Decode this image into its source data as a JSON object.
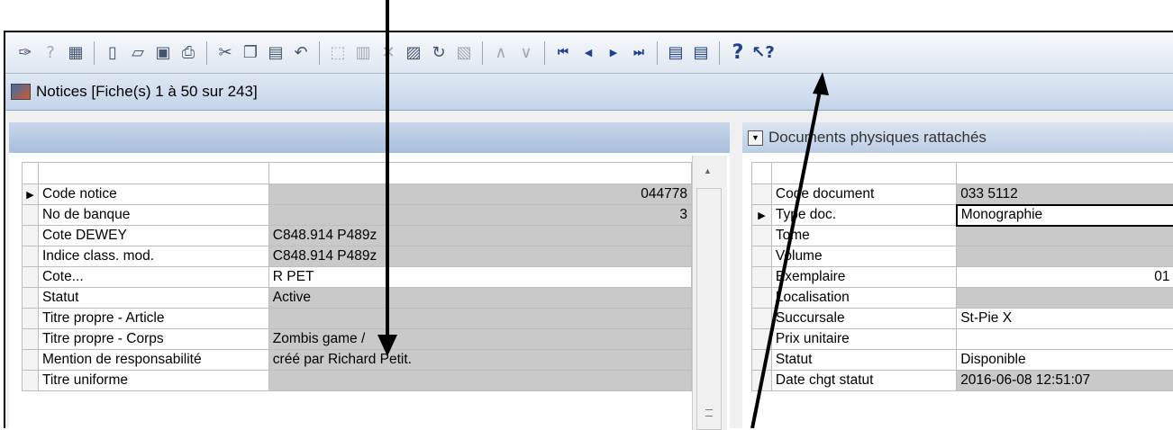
{
  "toolbar": {
    "icons": [
      "chart-edit-icon",
      "help-small-icon",
      "grid-icon",
      "new-document-icon",
      "open-folder-icon",
      "save-icon",
      "print-icon",
      "cut-icon",
      "copy-icon",
      "paste-icon",
      "undo-icon",
      "select-frame-icon",
      "book-icon",
      "delete-icon",
      "sheet-icon",
      "refresh-icon",
      "properties-icon",
      "up-chevron-icon",
      "down-chevron-icon",
      "first-record-icon",
      "previous-record-icon",
      "next-record-icon",
      "last-record-icon",
      "form-view-icon",
      "list-view-icon",
      "help-icon",
      "context-help-icon"
    ]
  },
  "window": {
    "title": "Notices [Fiche(s) 1 à 50 sur 243]"
  },
  "left_table": {
    "rows": [
      {
        "label": "Code notice",
        "value": "044778",
        "align": "right",
        "style": "grey",
        "current": true
      },
      {
        "label": "No de banque",
        "value": "3",
        "align": "right",
        "style": "grey",
        "current": false
      },
      {
        "label": "Cote DEWEY",
        "value": "C848.914 P489z",
        "align": "left",
        "style": "grey",
        "current": false
      },
      {
        "label": "Indice class. mod.",
        "value": "C848.914 P489z",
        "align": "left",
        "style": "grey",
        "current": false
      },
      {
        "label": "Cote...",
        "value": "R PET",
        "align": "left",
        "style": "white",
        "current": false
      },
      {
        "label": "Statut",
        "value": "Active",
        "align": "left",
        "style": "grey",
        "current": false
      },
      {
        "label": "Titre propre - Article",
        "value": "",
        "align": "left",
        "style": "grey",
        "current": false
      },
      {
        "label": "Titre propre - Corps",
        "value": "Zombis game /",
        "align": "left",
        "style": "grey",
        "current": false
      },
      {
        "label": "Mention de responsabilité",
        "value": "créé par Richard Petit.",
        "align": "left",
        "style": "grey",
        "current": false
      },
      {
        "label": "Titre uniforme",
        "value": "",
        "align": "left",
        "style": "grey",
        "current": false
      }
    ]
  },
  "right_panel": {
    "title": "Documents physiques rattachés",
    "rows": [
      {
        "label": "Code document",
        "value": "033 5112",
        "align": "left",
        "style": "grey",
        "current": false
      },
      {
        "label": "Type doc.",
        "value": "Monographie",
        "align": "left",
        "style": "white",
        "current": true
      },
      {
        "label": "Tome",
        "value": "",
        "align": "left",
        "style": "grey",
        "current": false
      },
      {
        "label": "Volume",
        "value": "",
        "align": "left",
        "style": "grey",
        "current": false
      },
      {
        "label": "Exemplaire",
        "value": "01",
        "align": "right",
        "style": "white",
        "current": false
      },
      {
        "label": "Localisation",
        "value": "",
        "align": "left",
        "style": "grey",
        "current": false
      },
      {
        "label": "Succursale",
        "value": "St-Pie X",
        "align": "left",
        "style": "white",
        "current": false
      },
      {
        "label": "Prix unitaire",
        "value": "",
        "align": "left",
        "style": "white",
        "current": false
      },
      {
        "label": "Statut",
        "value": "Disponible",
        "align": "left",
        "style": "white",
        "current": false
      },
      {
        "label": "Date chgt statut",
        "value": "2016-06-08 12:51:07",
        "align": "left",
        "style": "grey",
        "current": false
      }
    ]
  },
  "colors": {
    "toolbar_bg": "#e6ecf4",
    "titlebar_bg": "#cddbed",
    "cell_grey": "#c9c9c9",
    "nav_blue": "#1f3f8f"
  }
}
